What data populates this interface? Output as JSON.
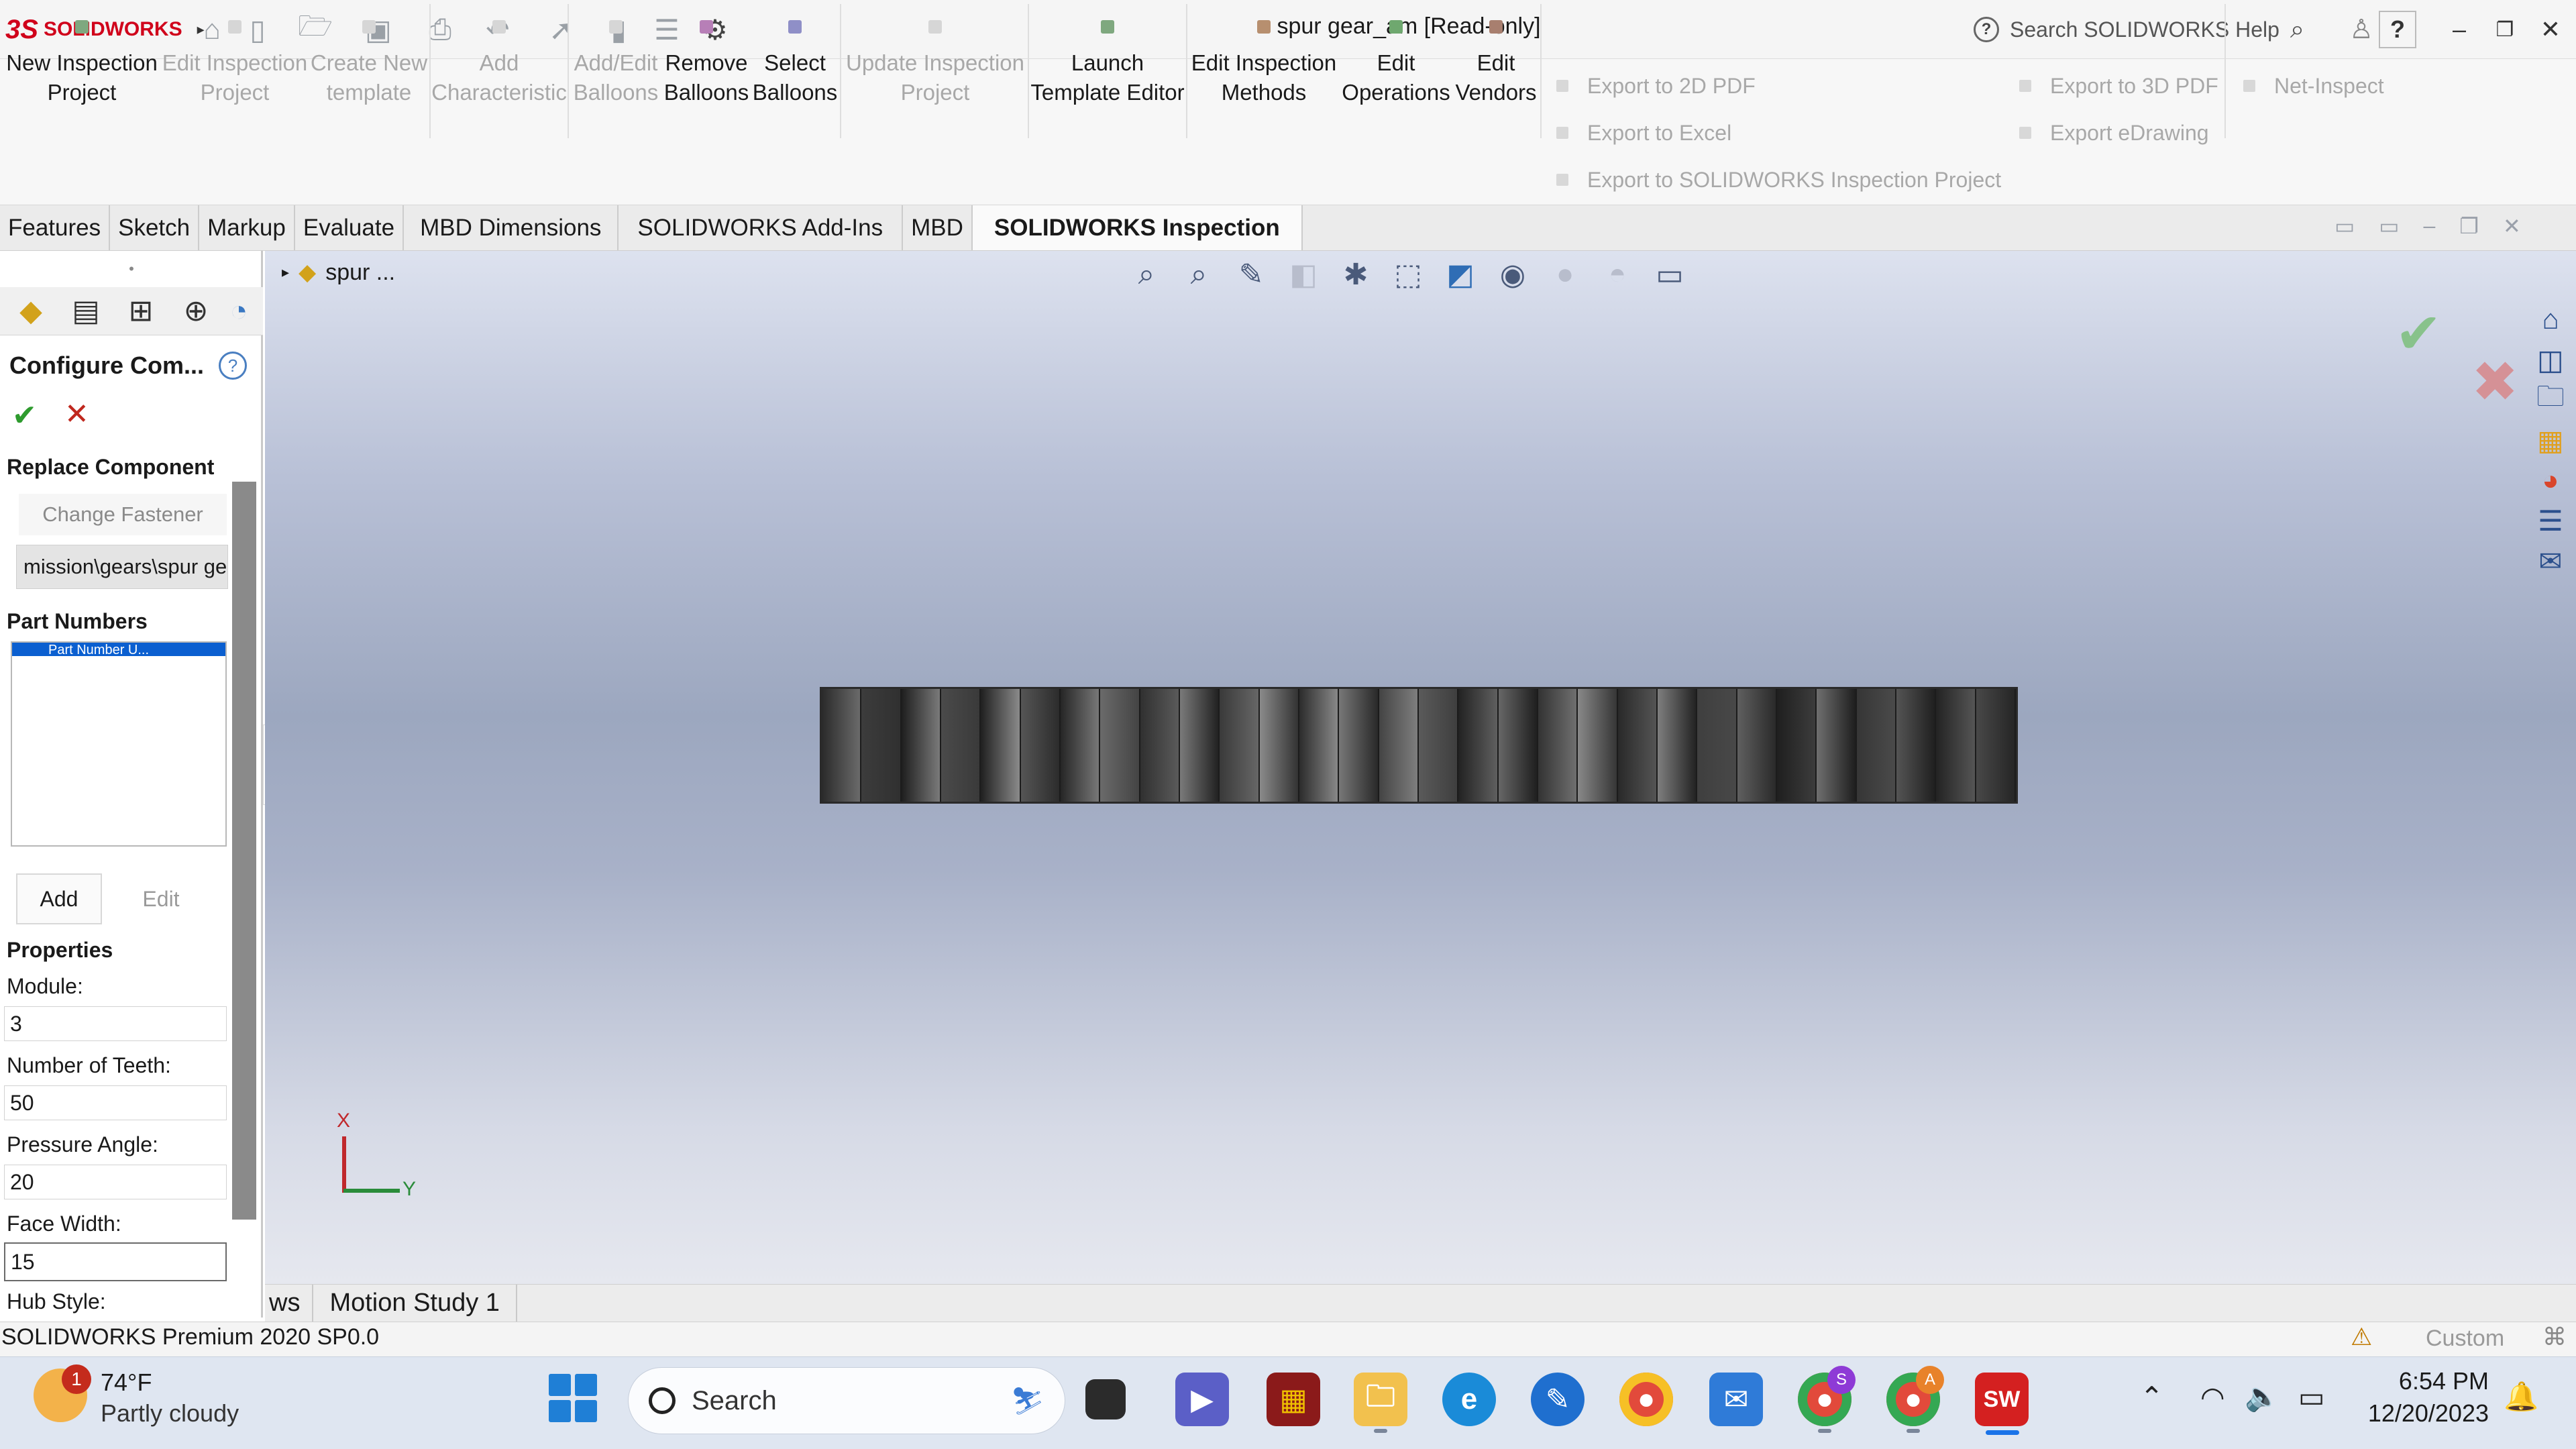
{
  "titlebar": {
    "brand": "SOLIDWORKS",
    "brand_mark": "3S",
    "document_title": "spur gear_am [Read-only]",
    "search_placeholder": "Search SOLIDWORKS Help",
    "help_label": "?"
  },
  "ribbon": {
    "new_project": "New Inspection\nProject",
    "edit_project": "Edit Inspection\nProject",
    "create_template": "Create New\ntemplate",
    "add_characteristic": "Add\nCharacteristic",
    "add_edit_balloons": "Add/Edit\nBalloons",
    "remove_balloons": "Remove\nBalloons",
    "select_balloons": "Select\nBalloons",
    "update_project": "Update Inspection\nProject",
    "launch_template_editor": "Launch\nTemplate Editor",
    "edit_methods": "Edit Inspection\nMethods",
    "edit_operations": "Edit\nOperations",
    "edit_vendors": "Edit\nVendors",
    "export_2d_pdf": "Export to 2D PDF",
    "export_excel": "Export to Excel",
    "export_sw_inspection": "Export to SOLIDWORKS Inspection Project",
    "export_3d_pdf": "Export to 3D PDF",
    "export_edrawing": "Export eDrawing",
    "net_inspect": "Net-Inspect"
  },
  "tabs": [
    "Features",
    "Sketch",
    "Markup",
    "Evaluate",
    "MBD Dimensions",
    "SOLIDWORKS Add-Ins",
    "MBD",
    "SOLIDWORKS Inspection"
  ],
  "panel": {
    "title": "Configure Com...",
    "replace_component": "Replace Component",
    "change_fastener": "Change Fastener",
    "path_value": "mission\\gears\\spur gear",
    "part_numbers": "Part Numbers",
    "list_selected": "Part Number U...",
    "add": "Add",
    "edit": "Edit",
    "properties": "Properties",
    "module_label": "Module:",
    "module_value": "3",
    "teeth_label": "Number of Teeth:",
    "teeth_value": "50",
    "pressure_label": "Pressure Angle:",
    "pressure_value": "20",
    "face_label": "Face Width:",
    "face_value": "15",
    "hub_label": "Hub Style:"
  },
  "viewport": {
    "tree_path": "spur ...",
    "triad_x": "X",
    "triad_y": "Y"
  },
  "bottom_tabs": [
    "ws",
    "Motion Study 1"
  ],
  "status": {
    "version": "SOLIDWORKS Premium 2020 SP0.0",
    "units": "Custom"
  },
  "taskbar": {
    "temperature": "74°F",
    "weather": "Partly cloudy",
    "weather_badge": "1",
    "search": "Search",
    "time": "6:54 PM",
    "date": "12/20/2023",
    "chrome_badge_s": "S",
    "chrome_badge_a": "A",
    "sw_label": "SW"
  },
  "colors": {
    "accent_blue": "#0b5fd0",
    "ok_green": "#2e9b2e",
    "cancel_red": "#c0281e",
    "brand_red": "#d0021b"
  }
}
